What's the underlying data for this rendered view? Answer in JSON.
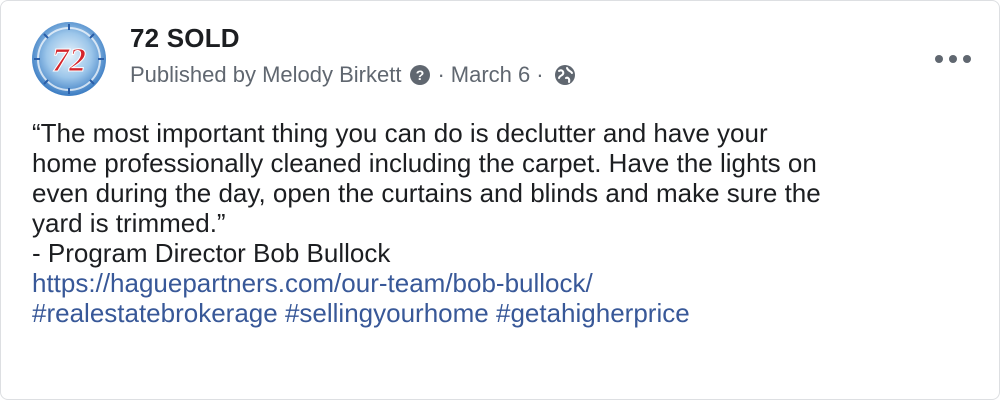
{
  "post": {
    "page_name": "72 SOLD",
    "avatar_text": "72",
    "published_by": "Published by Melody Birkett",
    "separator": "·",
    "date": "March 6",
    "quote": "“The most important thing you can do is declutter and have your\nhome professionally cleaned including the carpet. Have the lights on\neven during the day, open the curtains and blinds and make sure the\nyard is trimmed.”",
    "attribution": "- Program Director Bob Bullock",
    "link": "https://haguepartners.com/our-team/bob-bullock/",
    "hashtags": [
      "#realestatebrokerage",
      "#sellingyourhome",
      "#getahigherprice"
    ]
  },
  "icons": {
    "more": "more-options-icon",
    "help": "question-circle-icon",
    "audience": "globe-icon"
  },
  "colors": {
    "link": "#385898",
    "text": "#1c1e21",
    "meta": "#606770",
    "logo_red": "#d4242b",
    "logo_blue": "#3b7cc4"
  }
}
